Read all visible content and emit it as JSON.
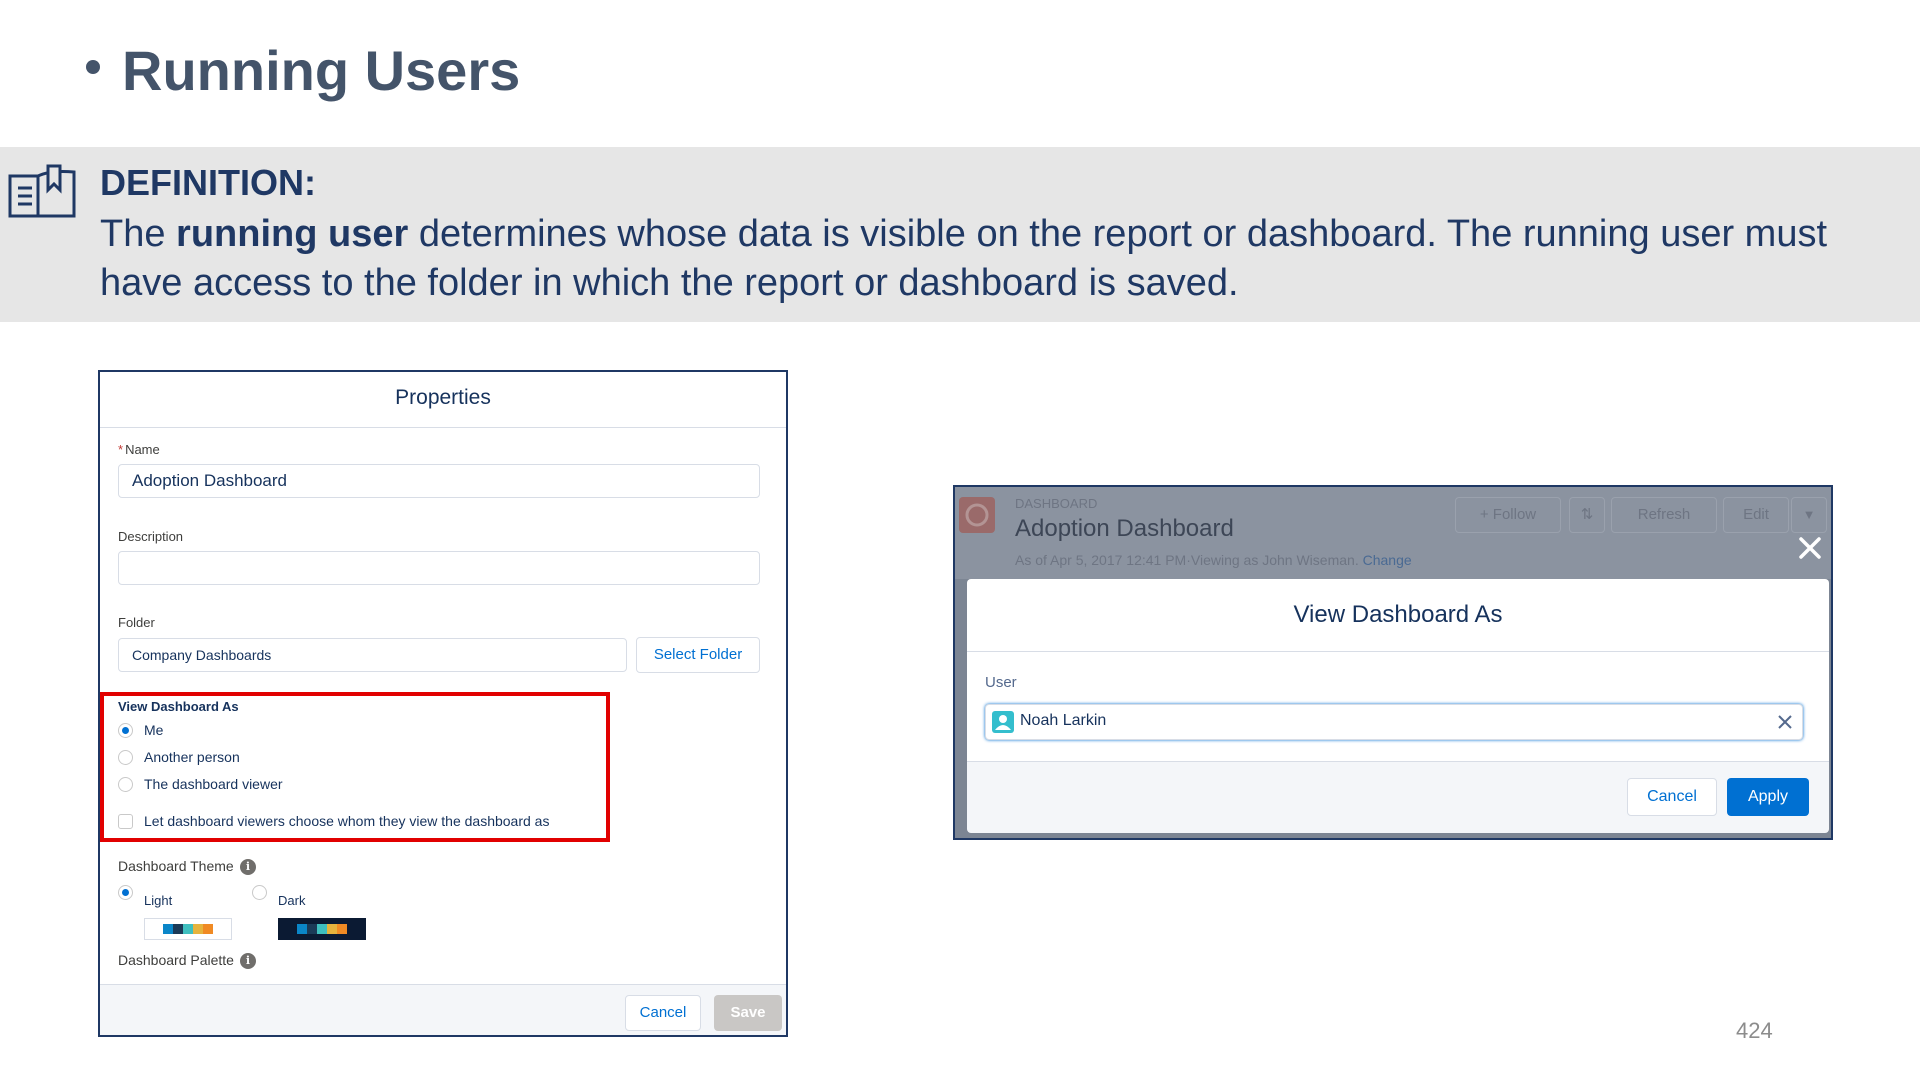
{
  "slide": {
    "title": "Running Users",
    "definition_heading": "DEFINITION:",
    "definition_pre": "The ",
    "definition_bold": "running user",
    "definition_post": " determines whose data is visible on the report or dashboard. The running user must have access to the folder in which the report or dashboard is saved.",
    "page_number": "424",
    "icon": "book-icon"
  },
  "properties": {
    "title": "Properties",
    "name_required_mark": "*",
    "name_label": "Name",
    "name_value": "Adoption Dashboard",
    "description_label": "Description",
    "description_value": "",
    "folder_label": "Folder",
    "folder_value": "Company Dashboards",
    "select_folder_label": "Select Folder",
    "view_as_label": "View Dashboard As",
    "view_as_options": [
      "Me",
      "Another person",
      "The dashboard viewer"
    ],
    "view_as_selected": "Me",
    "let_viewers_choose_label": "Let dashboard viewers choose whom they view the dashboard as",
    "let_viewers_choose_checked": false,
    "theme_label": "Dashboard Theme",
    "theme_options": [
      "Light",
      "Dark"
    ],
    "theme_selected": "Light",
    "palette_label": "Dashboard Palette",
    "info_glyph": "i",
    "cancel_label": "Cancel",
    "save_label": "Save",
    "swatch_colors": [
      "#0a86c8",
      "#1b3a57",
      "#3fbfbf",
      "#e6b33d",
      "#f08a24"
    ],
    "highlight_color": "#e10000"
  },
  "view_as_dialog": {
    "background_object_type": "DASHBOARD",
    "background_title": "Adoption Dashboard",
    "background_subtitle": "As of Apr 5, 2017 12:41 PM·Viewing as John Wiseman.",
    "background_change_link": "Change",
    "background_buttons": [
      "+ Follow",
      "Refresh",
      "Edit"
    ],
    "title": "View Dashboard As",
    "user_label": "User",
    "user_value": "Noah Larkin",
    "cancel_label": "Cancel",
    "apply_label": "Apply",
    "brand_color": "#0070d2"
  }
}
